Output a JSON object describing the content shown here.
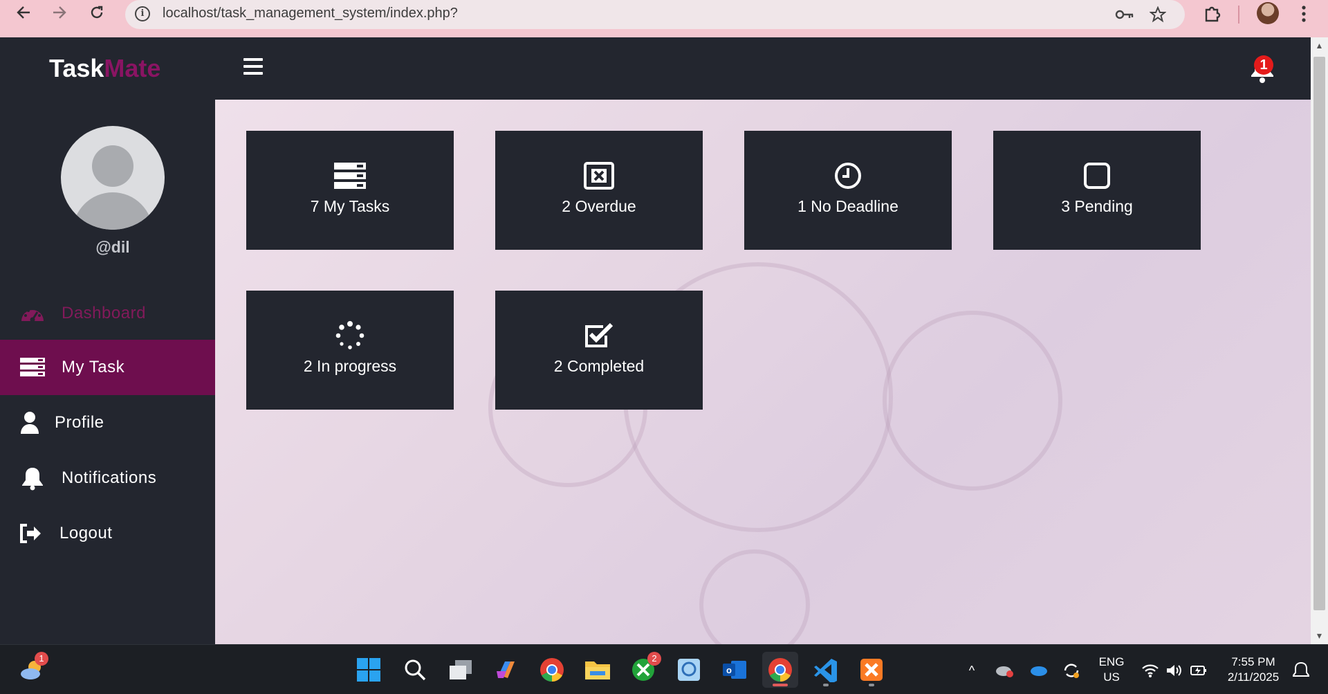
{
  "browser": {
    "url": "localhost/task_management_system/index.php?"
  },
  "header": {
    "logo_part1": "Task",
    "logo_part2": "Mate",
    "notification_count": "1"
  },
  "sidebar": {
    "username": "@dil",
    "items": [
      {
        "label": "Dashboard",
        "icon": "dashboard-gauge-icon"
      },
      {
        "label": "My Task",
        "icon": "tasks-list-icon"
      },
      {
        "label": "Profile",
        "icon": "user-icon"
      },
      {
        "label": "Notifications",
        "icon": "bell-icon"
      },
      {
        "label": "Logout",
        "icon": "sign-out-icon"
      }
    ]
  },
  "cards": [
    {
      "label": "7 My Tasks",
      "icon": "tasks-list-icon"
    },
    {
      "label": "2 Overdue",
      "icon": "window-close-icon"
    },
    {
      "label": "1 No Deadline",
      "icon": "clock-icon"
    },
    {
      "label": "3 Pending",
      "icon": "square-icon"
    },
    {
      "label": "2 In progress",
      "icon": "spinner-icon"
    },
    {
      "label": "2 Completed",
      "icon": "check-square-icon"
    }
  ],
  "taskbar": {
    "weather_badge": "1",
    "xbox_badge": "2",
    "language_line1": "ENG",
    "language_line2": "US",
    "time": "7:55 PM",
    "date": "2/11/2025"
  },
  "colors": {
    "brand_accent": "#8a1463",
    "active_menu": "#6e0e4e",
    "dark_panel": "#23262f",
    "badge_red": "#e41b1b"
  }
}
